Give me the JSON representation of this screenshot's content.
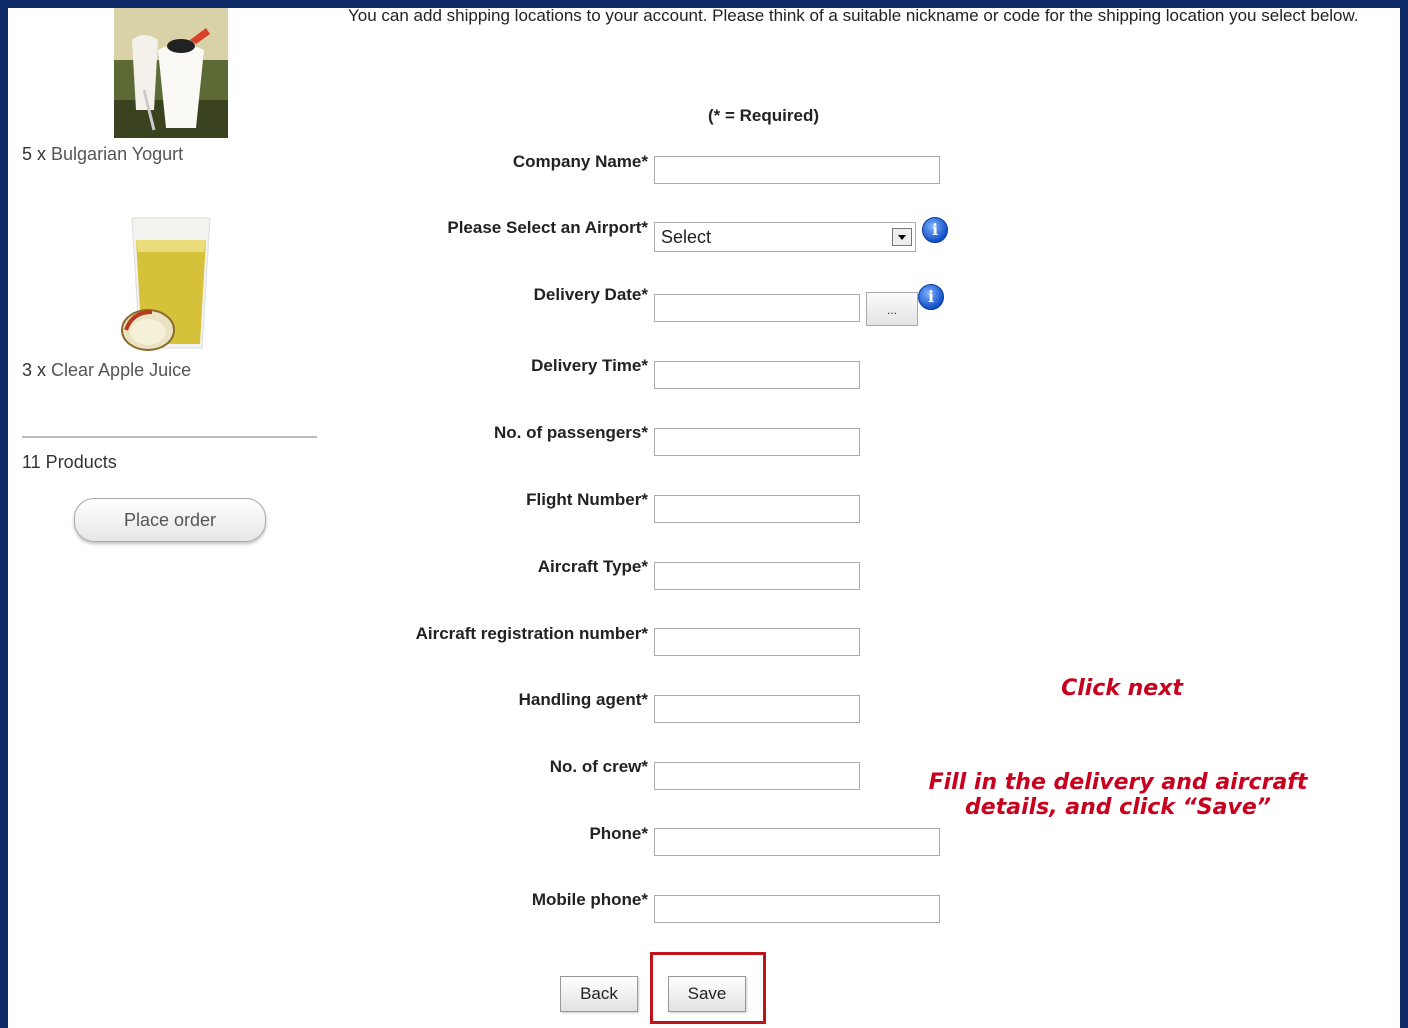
{
  "sidebar": {
    "products": [
      {
        "qty": "5 x",
        "name": "Bulgarian Yogurt"
      },
      {
        "qty": "3 x",
        "name": "Clear Apple Juice"
      }
    ],
    "product_count": "11 Products",
    "place_order_label": "Place order"
  },
  "form": {
    "intro": "You can add shipping locations to your account. Please think of a suitable nickname or code for the shipping location you select below.",
    "required_note": "(* = Required)",
    "fields": {
      "company_name": "Company Name*",
      "airport": "Please Select an Airport*",
      "delivery_date": "Delivery Date*",
      "delivery_time": "Delivery Time*",
      "passengers": "No. of passengers*",
      "flight_number": "Flight Number*",
      "aircraft_type": "Aircraft Type*",
      "aircraft_reg": "Aircraft registration number*",
      "handling_agent": "Handling agent*",
      "crew": "No. of crew*",
      "phone": "Phone*",
      "mobile_phone": "Mobile phone*"
    },
    "airport_selected": "Select",
    "date_picker_label": "...",
    "back_label": "Back",
    "save_label": "Save"
  },
  "annotations": {
    "click_next": "Click next",
    "fill_in": "Fill in the delivery and aircraft details, and click “Save”"
  },
  "colors": {
    "frame": "#0e2a66",
    "annotation": "#c8001e",
    "highlight": "#c0141c"
  }
}
